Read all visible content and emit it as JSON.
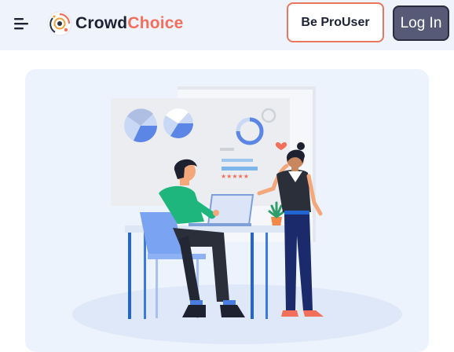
{
  "header": {
    "brand_part1": "Crowd",
    "brand_part2": "Choice",
    "pro_button_label": "Be ProUser",
    "login_button_label": "Log In"
  },
  "icons": {
    "menu": "hamburger-menu-icon",
    "logo": "crowdchoice-logo-icon"
  },
  "colors": {
    "header_bg": "#eff3fb",
    "brand_dark": "#1c2233",
    "brand_accent": "#f26f5c",
    "pro_border": "#e9765f",
    "login_bg": "#565a77",
    "hero_bg": "#edf3fd"
  },
  "hero": {
    "illustration": "two-people-reviewing-charts-at-desk"
  }
}
